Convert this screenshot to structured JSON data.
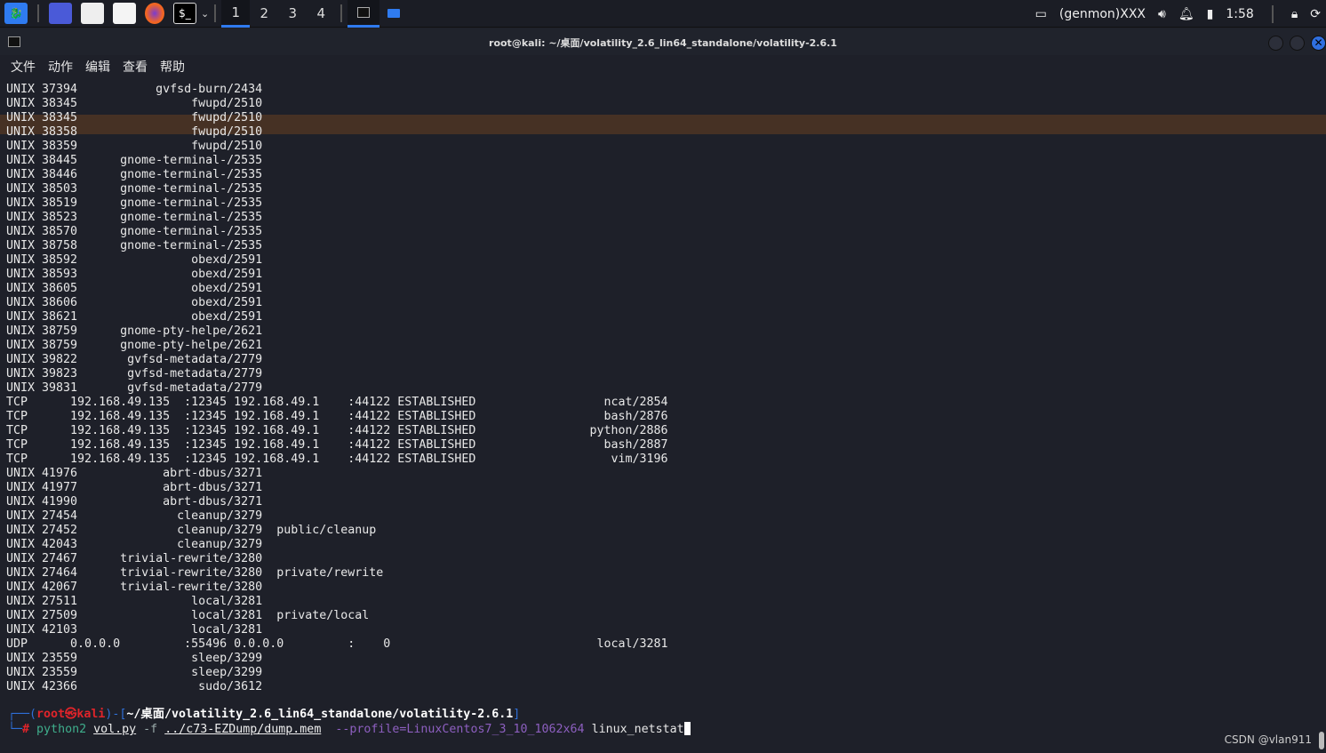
{
  "taskbar": {
    "workspaces": [
      "1",
      "2",
      "3",
      "4"
    ],
    "active_workspace": "1",
    "tray_genmon": "(genmon)XXX",
    "clock": "1:58",
    "accent": "#2f7bf0"
  },
  "window": {
    "title": "root@kali: ~/桌面/volatility_2.6_lin64_standalone/volatility-2.6.1"
  },
  "menu": [
    "文件",
    "动作",
    "编辑",
    "查看",
    "帮助"
  ],
  "rows": [
    {
      "proto": "UNIX",
      "inode": "37394",
      "process": "gvfsd-burn/2434"
    },
    {
      "proto": "UNIX",
      "inode": "38345",
      "process": "fwupd/2510"
    },
    {
      "proto": "UNIX",
      "inode": "38345",
      "process": "fwupd/2510"
    },
    {
      "proto": "UNIX",
      "inode": "38358",
      "process": "fwupd/2510"
    },
    {
      "proto": "UNIX",
      "inode": "38359",
      "process": "fwupd/2510"
    },
    {
      "proto": "UNIX",
      "inode": "38445",
      "process": "gnome-terminal-/2535"
    },
    {
      "proto": "UNIX",
      "inode": "38446",
      "process": "gnome-terminal-/2535"
    },
    {
      "proto": "UNIX",
      "inode": "38503",
      "process": "gnome-terminal-/2535"
    },
    {
      "proto": "UNIX",
      "inode": "38519",
      "process": "gnome-terminal-/2535"
    },
    {
      "proto": "UNIX",
      "inode": "38523",
      "process": "gnome-terminal-/2535"
    },
    {
      "proto": "UNIX",
      "inode": "38570",
      "process": "gnome-terminal-/2535"
    },
    {
      "proto": "UNIX",
      "inode": "38758",
      "process": "gnome-terminal-/2535"
    },
    {
      "proto": "UNIX",
      "inode": "38592",
      "process": "obexd/2591"
    },
    {
      "proto": "UNIX",
      "inode": "38593",
      "process": "obexd/2591"
    },
    {
      "proto": "UNIX",
      "inode": "38605",
      "process": "obexd/2591"
    },
    {
      "proto": "UNIX",
      "inode": "38606",
      "process": "obexd/2591"
    },
    {
      "proto": "UNIX",
      "inode": "38621",
      "process": "obexd/2591"
    },
    {
      "proto": "UNIX",
      "inode": "38759",
      "process": "gnome-pty-helpe/2621"
    },
    {
      "proto": "UNIX",
      "inode": "38759",
      "process": "gnome-pty-helpe/2621"
    },
    {
      "proto": "UNIX",
      "inode": "39822",
      "process": "gvfsd-metadata/2779"
    },
    {
      "proto": "UNIX",
      "inode": "39823",
      "process": "gvfsd-metadata/2779"
    },
    {
      "proto": "UNIX",
      "inode": "39831",
      "process": "gvfsd-metadata/2779"
    },
    {
      "proto": "TCP",
      "local_ip": "192.168.49.135",
      "local_port": ":12345",
      "remote_ip": "192.168.49.1",
      "remote_port": ":44122",
      "state": "ESTABLISHED",
      "process": "ncat/2854"
    },
    {
      "proto": "TCP",
      "local_ip": "192.168.49.135",
      "local_port": ":12345",
      "remote_ip": "192.168.49.1",
      "remote_port": ":44122",
      "state": "ESTABLISHED",
      "process": "bash/2876"
    },
    {
      "proto": "TCP",
      "local_ip": "192.168.49.135",
      "local_port": ":12345",
      "remote_ip": "192.168.49.1",
      "remote_port": ":44122",
      "state": "ESTABLISHED",
      "process": "python/2886"
    },
    {
      "proto": "TCP",
      "local_ip": "192.168.49.135",
      "local_port": ":12345",
      "remote_ip": "192.168.49.1",
      "remote_port": ":44122",
      "state": "ESTABLISHED",
      "process": "bash/2887"
    },
    {
      "proto": "TCP",
      "local_ip": "192.168.49.135",
      "local_port": ":12345",
      "remote_ip": "192.168.49.1",
      "remote_port": ":44122",
      "state": "ESTABLISHED",
      "process": "vim/3196"
    },
    {
      "proto": "UNIX",
      "inode": "41976",
      "process": "abrt-dbus/3271"
    },
    {
      "proto": "UNIX",
      "inode": "41977",
      "process": "abrt-dbus/3271"
    },
    {
      "proto": "UNIX",
      "inode": "41990",
      "process": "abrt-dbus/3271"
    },
    {
      "proto": "UNIX",
      "inode": "27454",
      "process": "cleanup/3279"
    },
    {
      "proto": "UNIX",
      "inode": "27452",
      "process": "cleanup/3279",
      "path": "public/cleanup"
    },
    {
      "proto": "UNIX",
      "inode": "42043",
      "process": "cleanup/3279"
    },
    {
      "proto": "UNIX",
      "inode": "27467",
      "process": "trivial-rewrite/3280"
    },
    {
      "proto": "UNIX",
      "inode": "27464",
      "process": "trivial-rewrite/3280",
      "path": "private/rewrite"
    },
    {
      "proto": "UNIX",
      "inode": "42067",
      "process": "trivial-rewrite/3280"
    },
    {
      "proto": "UNIX",
      "inode": "27511",
      "process": "local/3281"
    },
    {
      "proto": "UNIX",
      "inode": "27509",
      "process": "local/3281",
      "path": "private/local"
    },
    {
      "proto": "UNIX",
      "inode": "42103",
      "process": "local/3281"
    },
    {
      "proto": "UDP",
      "local_ip": "0.0.0.0",
      "local_port": ":55496",
      "remote_ip": "0.0.0.0",
      "remote_port": ":",
      "udp_state": "0",
      "process": "local/3281"
    },
    {
      "proto": "UNIX",
      "inode": "23559",
      "process": "sleep/3299"
    },
    {
      "proto": "UNIX",
      "inode": "23559",
      "process": "sleep/3299"
    },
    {
      "proto": "UNIX",
      "inode": "42366",
      "process": "sudo/3612"
    }
  ],
  "prompt": {
    "user_host": "root㉿kali",
    "cwd": "~/桌面/volatility_2.6_lin64_standalone/volatility-2.6.1",
    "symbol": "#",
    "cmd": "python2",
    "script": "vol.py",
    "flag": "-f",
    "file": "../c73-EZDump/dump.mem",
    "profile": "--profile=LinuxCentos7_3_10_1062x64",
    "plugin": "linux_netstat"
  },
  "watermark": "CSDN @vlan911"
}
